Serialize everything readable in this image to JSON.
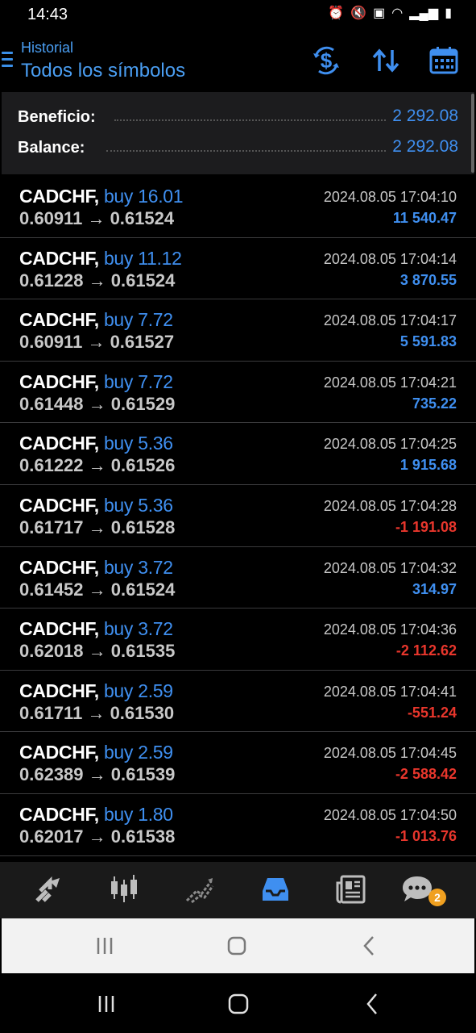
{
  "status": {
    "time": "14:43",
    "icons": [
      "alarm-icon",
      "mute-icon",
      "nfc-icon",
      "wifi-icon",
      "signal-icon",
      "battery-icon"
    ]
  },
  "header": {
    "subtitle": "Historial",
    "title": "Todos los símbolos",
    "actions": [
      "currency-exchange-icon",
      "sort-icon",
      "calendar-icon"
    ]
  },
  "summary": {
    "profit_label": "Beneficio:",
    "profit_value": "2 292.08",
    "balance_label": "Balance:",
    "balance_value": "2 292.08"
  },
  "trades": [
    {
      "symbol": "CADCHF,",
      "type": "buy 16.01",
      "open": "0.60911",
      "close": "0.61524",
      "date": "2024.08.05 17:04:10",
      "profit": "11 540.47",
      "sign": "pos"
    },
    {
      "symbol": "CADCHF,",
      "type": "buy 11.12",
      "open": "0.61228",
      "close": "0.61524",
      "date": "2024.08.05 17:04:14",
      "profit": "3 870.55",
      "sign": "pos"
    },
    {
      "symbol": "CADCHF,",
      "type": "buy 7.72",
      "open": "0.60911",
      "close": "0.61527",
      "date": "2024.08.05 17:04:17",
      "profit": "5 591.83",
      "sign": "pos"
    },
    {
      "symbol": "CADCHF,",
      "type": "buy 7.72",
      "open": "0.61448",
      "close": "0.61529",
      "date": "2024.08.05 17:04:21",
      "profit": "735.22",
      "sign": "pos"
    },
    {
      "symbol": "CADCHF,",
      "type": "buy 5.36",
      "open": "0.61222",
      "close": "0.61526",
      "date": "2024.08.05 17:04:25",
      "profit": "1 915.68",
      "sign": "pos"
    },
    {
      "symbol": "CADCHF,",
      "type": "buy 5.36",
      "open": "0.61717",
      "close": "0.61528",
      "date": "2024.08.05 17:04:28",
      "profit": "-1 191.08",
      "sign": "neg"
    },
    {
      "symbol": "CADCHF,",
      "type": "buy 3.72",
      "open": "0.61452",
      "close": "0.61524",
      "date": "2024.08.05 17:04:32",
      "profit": "314.97",
      "sign": "pos"
    },
    {
      "symbol": "CADCHF,",
      "type": "buy 3.72",
      "open": "0.62018",
      "close": "0.61535",
      "date": "2024.08.05 17:04:36",
      "profit": "-2 112.62",
      "sign": "neg"
    },
    {
      "symbol": "CADCHF,",
      "type": "buy 2.59",
      "open": "0.61711",
      "close": "0.61530",
      "date": "2024.08.05 17:04:41",
      "profit": "-551.24",
      "sign": "neg"
    },
    {
      "symbol": "CADCHF,",
      "type": "buy 2.59",
      "open": "0.62389",
      "close": "0.61539",
      "date": "2024.08.05 17:04:45",
      "profit": "-2 588.42",
      "sign": "neg"
    },
    {
      "symbol": "CADCHF,",
      "type": "buy 1.80",
      "open": "0.62017",
      "close": "0.61538",
      "date": "2024.08.05 17:04:50",
      "profit": "-1 013.76",
      "sign": "neg"
    }
  ],
  "arrow": "→",
  "bottom_nav": {
    "items": [
      "quotes-icon",
      "chart-icon",
      "trade-icon",
      "history-icon",
      "news-icon",
      "chat-icon"
    ],
    "active": "history-icon",
    "chat_badge": "2"
  },
  "colors": {
    "accent": "#3f8ff0",
    "negative": "#e8362c",
    "badge": "#f0a020"
  }
}
